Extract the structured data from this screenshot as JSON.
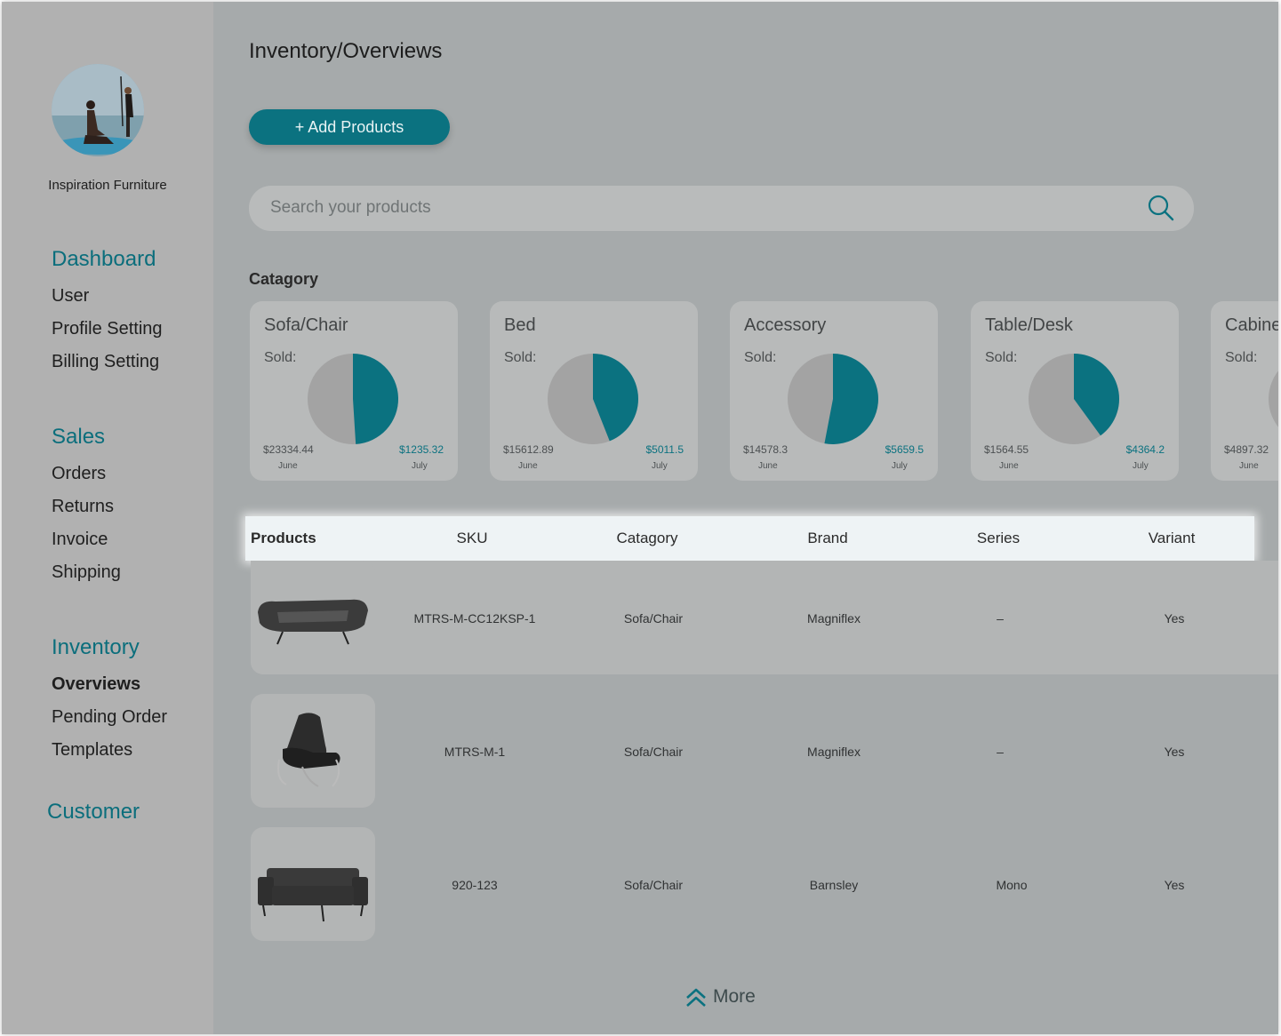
{
  "sidebar": {
    "company_name": "Inspiration Furniture",
    "sections": [
      {
        "label": "Dashboard",
        "items": [
          "User",
          "Profile Setting",
          "Billing Setting"
        ]
      },
      {
        "label": "Sales",
        "items": [
          "Orders",
          "Returns",
          "Invoice",
          "Shipping"
        ]
      },
      {
        "label": "Inventory",
        "items": [
          "Overviews",
          "Pending Order",
          "Templates"
        ]
      },
      {
        "label": "Customer",
        "items": []
      }
    ],
    "active_item": "Overviews"
  },
  "header": {
    "breadcrumb": "Inventory/Overviews",
    "add_button_label": "+ Add Products"
  },
  "search": {
    "placeholder": "Search your products"
  },
  "categories": {
    "label": "Catagory",
    "sold_label": "Sold:",
    "june_label": "June",
    "july_label": "July",
    "cards": [
      {
        "name": "Sofa/Chair",
        "june": "$23334.44",
        "july": "$1235.32",
        "july_share": 0.49
      },
      {
        "name": "Bed",
        "june": "$15612.89",
        "july": "$5011.5",
        "july_share": 0.44
      },
      {
        "name": "Accessory",
        "june": "$14578.3",
        "july": "$5659.5",
        "july_share": 0.53
      },
      {
        "name": "Table/Desk",
        "june": "$1564.55",
        "july": "$4364.2",
        "july_share": 0.4
      },
      {
        "name": "Cabinet",
        "june": "$4897.32",
        "july": "",
        "july_share": 0.45
      }
    ]
  },
  "table": {
    "columns": [
      "Products",
      "SKU",
      "Catagory",
      "Brand",
      "Series",
      "Variant"
    ],
    "rows": [
      {
        "image": "sofa-modern-icon",
        "sku": "MTRS-M-CC12KSP-1",
        "category": "Sofa/Chair",
        "brand": "Magniflex",
        "series": "–",
        "variant": "Yes"
      },
      {
        "image": "recliner-chair-icon",
        "sku": "MTRS-M-1",
        "category": "Sofa/Chair",
        "brand": "Magniflex",
        "series": "–",
        "variant": "Yes"
      },
      {
        "image": "couch-icon",
        "sku": "920-123",
        "category": "Sofa/Chair",
        "brand": "Barnsley",
        "series": "Mono",
        "variant": "Yes"
      }
    ]
  },
  "more_label": "More",
  "colors": {
    "accent": "#0b7280",
    "pie_gray": "#a3a3a3",
    "sidebar_bg": "#b1b1b1",
    "main_bg": "#a6aaab"
  }
}
